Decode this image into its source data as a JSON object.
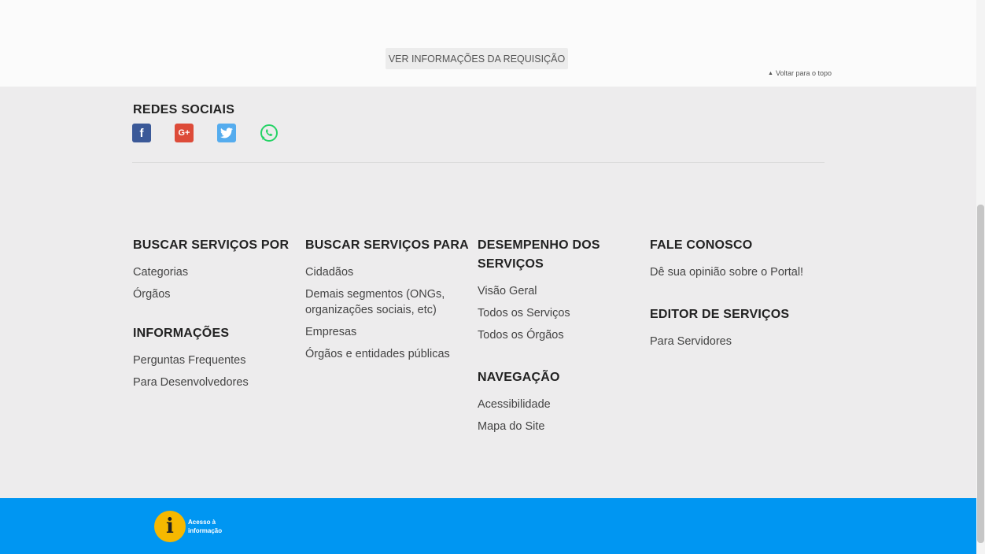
{
  "top": {
    "request_button": "VER INFORMAÇÕES DA REQUISIÇÃO",
    "back_to_top_arrow": "▲",
    "back_to_top": "Voltar para o topo"
  },
  "social": {
    "title": "REDES SOCIAIS",
    "icons": [
      {
        "name": "facebook-icon",
        "glyph": "f",
        "color": "#3b5998"
      },
      {
        "name": "google-plus-icon",
        "glyph": "G+",
        "color": "#dd4b39"
      },
      {
        "name": "twitter-icon",
        "glyph": "t",
        "color": "#55acee"
      },
      {
        "name": "whatsapp-icon",
        "glyph": "",
        "color": "#25d366"
      }
    ]
  },
  "columns": {
    "buscar_por": {
      "title": "BUSCAR SERVIÇOS POR",
      "items": [
        "Categorias",
        "Órgãos"
      ]
    },
    "informacoes": {
      "title": "INFORMAÇÕES",
      "items": [
        "Perguntas Frequentes",
        "Para Desenvolvedores"
      ]
    },
    "buscar_para": {
      "title": "BUSCAR SERVIÇOS PARA",
      "items": [
        "Cidadãos",
        "Demais segmentos (ONGs, organizações sociais, etc)",
        "Empresas",
        "Órgãos e entidades públicas"
      ]
    },
    "desempenho": {
      "title": "DESEMPENHO DOS SERVIÇOS",
      "items": [
        "Visão Geral",
        "Todos os Serviços",
        "Todos os Órgãos"
      ]
    },
    "navegacao": {
      "title": "NAVEGAÇÃO",
      "items": [
        "Acessibilidade",
        "Mapa do Site"
      ]
    },
    "fale_conosco": {
      "title": "FALE CONOSCO",
      "items": [
        "Dê sua opinião sobre o Portal!"
      ]
    },
    "editor": {
      "title": "EDITOR DE SERVIÇOS",
      "items": [
        "Para Servidores"
      ]
    }
  },
  "footer": {
    "info_glyph": "i",
    "info_text": "Acesso à informação",
    "colors": {
      "bar": "#0096f2",
      "badge": "#f6b800"
    }
  }
}
